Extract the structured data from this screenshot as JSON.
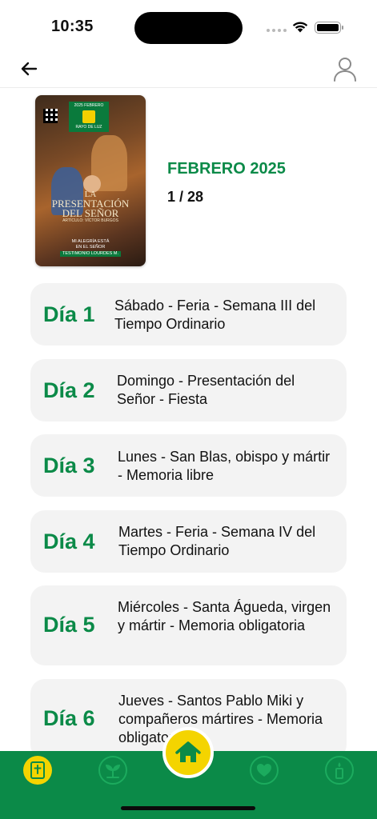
{
  "status_bar": {
    "time": "10:35"
  },
  "nav": {
    "back_icon": "arrow-left-icon",
    "profile_icon": "user-icon"
  },
  "issue": {
    "month_title": "FEBRERO 2025",
    "page_indicator": "1 / 28",
    "cover": {
      "edition": "2025 FEBRERO",
      "brand": "RAYO DE LUZ",
      "title_line1": "LA",
      "title_line2": "PRESENTACIÓN",
      "title_line3": "DEL SEÑOR",
      "article": "ARTÍCULO: VÍCTOR BURGOS",
      "footer_line1": "MI ALEGRÍA ESTÁ",
      "footer_line2": "EN EL SEÑOR",
      "footer_band": "TESTIMONIO LOURDES M."
    }
  },
  "days": [
    {
      "label": "Día 1",
      "description": "Sábado - Feria - Semana III del Tiempo Ordinario"
    },
    {
      "label": "Día 2",
      "description": "Domingo - Presentación del Señor - Fiesta"
    },
    {
      "label": "Día 3",
      "description": "Lunes - San Blas, obispo y mártir - Memoria libre"
    },
    {
      "label": "Día 4",
      "description": "Martes - Feria - Semana IV del Tiempo Ordinario"
    },
    {
      "label": "Día 5",
      "description": "Miércoles - Santa Águeda, virgen y mártir - Memoria obligatoria"
    },
    {
      "label": "Día 6",
      "description": "Jueves - Santos Pablo Miki y compañeros mártires - Memoria obligatoria"
    }
  ],
  "tab_bar": {
    "tabs": [
      {
        "icon": "bible-icon",
        "active": true
      },
      {
        "icon": "sprout-icon",
        "active": false
      },
      {
        "icon": "home-icon",
        "active": false
      },
      {
        "icon": "heart-icon",
        "active": false
      },
      {
        "icon": "candle-icon",
        "active": false
      }
    ]
  },
  "colors": {
    "accent_green": "#0b8a48",
    "accent_yellow": "#f4d400",
    "card_bg": "#f3f3f3"
  }
}
